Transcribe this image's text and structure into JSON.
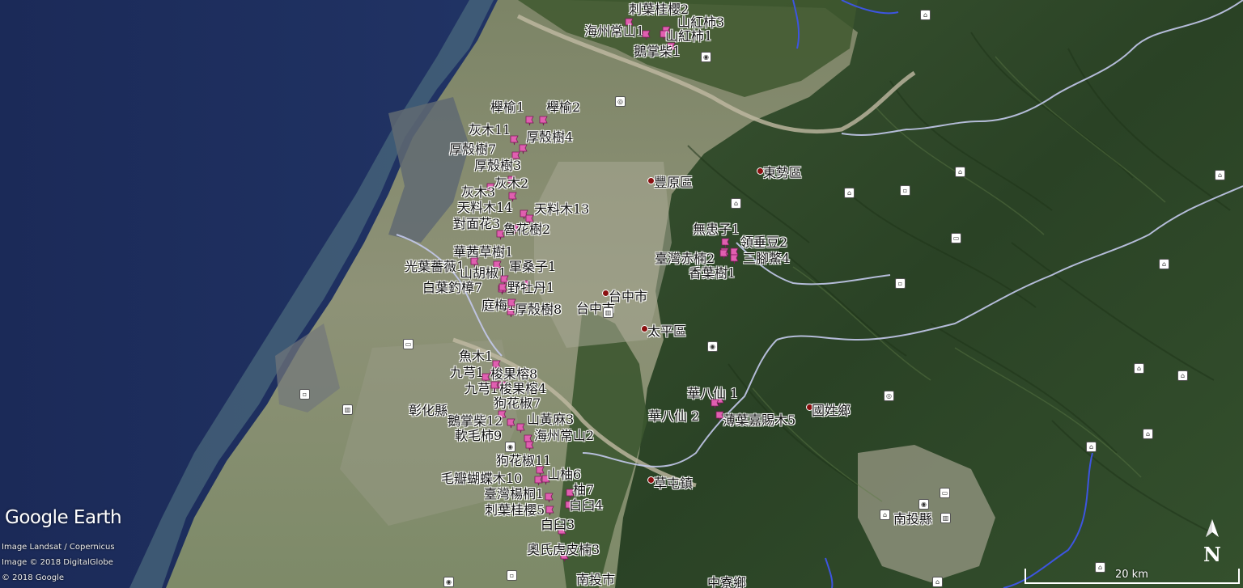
{
  "branding": {
    "logo": "Google Earth",
    "credits": [
      "Image Landsat / Copernicus",
      "Image © 2018 DigitalGlobe",
      "© 2018 Google"
    ]
  },
  "scale": {
    "label": "20 km"
  },
  "compass": {
    "label": "N"
  },
  "colors": {
    "pin": "#e05fb0",
    "sea": "#22356a",
    "mountain": "#2f4a2a",
    "plain": "#8a8f6f",
    "boundary": "#c7cde8",
    "river": "#3a4fd8"
  },
  "places": [
    {
      "name": "豐原區"
    },
    {
      "name": "東勢區"
    },
    {
      "name": "台中市"
    },
    {
      "name": "太平區"
    },
    {
      "name": "彰化縣"
    },
    {
      "name": "國姓鄉"
    },
    {
      "name": "草屯鎮"
    },
    {
      "name": "南投縣"
    },
    {
      "name": "南投市"
    },
    {
      "name": "中寮鄉"
    },
    {
      "name": "台中市"
    }
  ],
  "specimens": [
    "刺葉桂櫻2",
    "山紅柿3",
    "海州常山1",
    "山紅柿1",
    "鵝掌柴1",
    "櫸榆1",
    "櫸榆2",
    "灰木11",
    "厚殼樹4",
    "厚殼樹7",
    "厚殼樹3",
    "灰木2",
    "灰木3",
    "天料木14",
    "天料木13",
    "對面花3",
    "魯花樹2",
    "華茜草樹1",
    "光葉薔薇1",
    "山胡椒1",
    "軍桑子1",
    "白葉釣樟7",
    "野牡丹1",
    "庭梅1",
    "厚殼樹8",
    "無患子1",
    "領垂豆2",
    "臺灣赤楠2",
    "三腳鱉4",
    "香葉樹1",
    "魚木1",
    "九芎1",
    "梭果榕8",
    "九芎1",
    "梭果榕4",
    "狗花椒7",
    "鵝掌柴12",
    "山黃麻3",
    "軟毛柿9",
    "海州常山2",
    "華八仙 1",
    "華八仙 2",
    "薄葉嘉賜木5",
    "狗花椒11",
    "山柚6",
    "毛瓣蝴蝶木10",
    "柚7",
    "臺灣楊桐1",
    "白臼4",
    "刺葉桂櫻5",
    "白臼3",
    "奧氏虎皮楠3"
  ]
}
